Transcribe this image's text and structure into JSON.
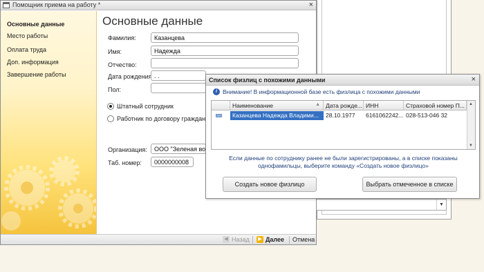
{
  "window": {
    "title": "Помощник приема на работу *",
    "close": "×"
  },
  "sidebar": {
    "items": [
      {
        "label": "Основные данные"
      },
      {
        "label": "Место работы"
      },
      {
        "label": "Оплата труда"
      },
      {
        "label": "Доп. информация"
      },
      {
        "label": "Завершение работы"
      }
    ]
  },
  "form": {
    "heading": "Основные данные",
    "surname_label": "Фамилия:",
    "surname_value": "Казанцева",
    "name_label": "Имя:",
    "name_value": "Надежда",
    "patronymic_label": "Отчество:",
    "patronymic_value": "",
    "birthdate_label": "Дата рождения:",
    "birthdate_value": " .  .",
    "sex_label": "Пол:",
    "sex_value": "",
    "radio_staff": "Штатный сотрудник",
    "radio_contract": "Работник по договору гражданско",
    "org_label": "Организация:",
    "org_value": "ООО \"Зеленая вол",
    "tab_label": "Таб. номер:",
    "tab_value": "0000000008"
  },
  "footer": {
    "back": "Назад",
    "next": "Далее",
    "cancel": "Отмена"
  },
  "dialog": {
    "title": "Список физлиц с похожими данными",
    "close": "×",
    "warning": "Внимание! В информационной базе есть физлица с похожими данными",
    "columns": [
      "Наименование",
      "Дата рожде...",
      "ИНН",
      "Страховой номер П..."
    ],
    "rows": [
      {
        "name": "Казанцева Надежда Владими...",
        "birth": "28.10.1977",
        "inn": "6161062242...",
        "snils": "028-513-046 32"
      }
    ],
    "info_line1": "Если данные по сотруднику ранее не были зарегистрированы, а в списке показаны",
    "info_line2": "однофамильцы, выберите команду «Создать новое физлицо»",
    "create_button": "Создать новое физлицо",
    "select_button": "Выбрать отмеченное в списке"
  },
  "colors": {
    "accent": "#f5b400",
    "selection": "#3470c2",
    "sidebar_bottom": "#f5c33c"
  }
}
